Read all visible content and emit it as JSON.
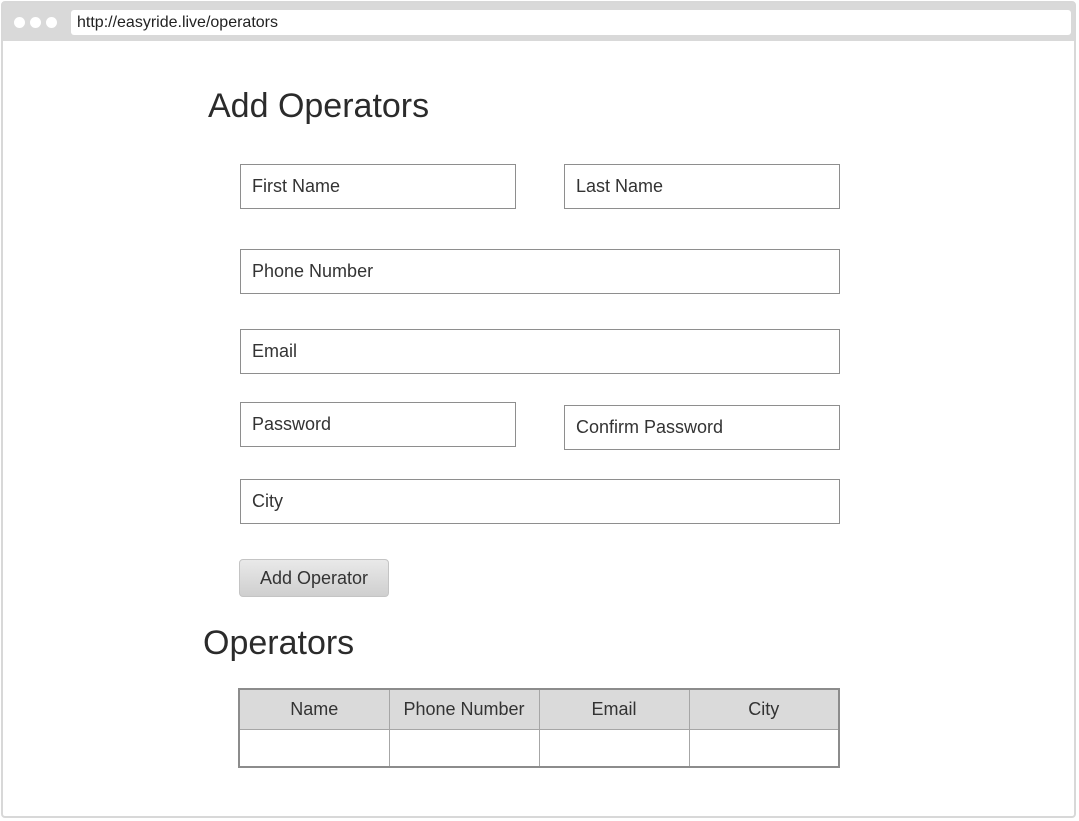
{
  "browser": {
    "url": "http://easyride.live/operators"
  },
  "form": {
    "title": "Add Operators",
    "first_name_placeholder": "First Name",
    "last_name_placeholder": "Last Name",
    "phone_placeholder": "Phone Number",
    "email_placeholder": "Email",
    "password_placeholder": "Password",
    "confirm_password_placeholder": "Confirm Password",
    "city_placeholder": "City",
    "submit_label": "Add Operator"
  },
  "operators": {
    "title": "Operators",
    "columns": [
      "Name",
      "Phone Number",
      "Email",
      "City"
    ],
    "rows": [
      [
        "",
        "",
        "",
        ""
      ]
    ]
  }
}
